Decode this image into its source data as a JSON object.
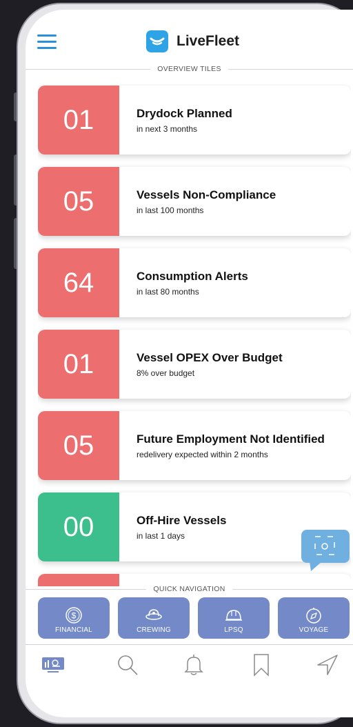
{
  "header": {
    "app_name": "LiveFleet"
  },
  "sections": {
    "overview": "OVERVIEW TILES",
    "quick_nav": "QUICK NAVIGATION"
  },
  "colors": {
    "accent": "#2a8fd8",
    "tile_red": "#ec6e6e",
    "tile_green": "#3cbf8c",
    "nav_button": "#7389c8",
    "chat_fab": "#6fb0e0"
  },
  "tiles": [
    {
      "count": "01",
      "title": "Drydock Planned",
      "subtitle": "in next 3 months",
      "status": "alert"
    },
    {
      "count": "05",
      "title": "Vessels Non-Compliance",
      "subtitle": "in last 100 months",
      "status": "alert"
    },
    {
      "count": "64",
      "title": "Consumption Alerts",
      "subtitle": "in last 80 months",
      "status": "alert"
    },
    {
      "count": "01",
      "title": "Vessel OPEX Over Budget",
      "subtitle": "8% over budget",
      "status": "alert"
    },
    {
      "count": "05",
      "title": "Future Employment Not Identified",
      "subtitle": "redelivery expected within 2 months",
      "status": "alert"
    },
    {
      "count": "00",
      "title": "Off-Hire Vessels",
      "subtitle": "in last 1 days",
      "status": "ok"
    },
    {
      "count": "",
      "title": "",
      "subtitle": "",
      "status": "alert"
    }
  ],
  "quick_nav": [
    {
      "label": "FINANCIAL",
      "icon": "dollar-icon"
    },
    {
      "label": "CREWING",
      "icon": "sailor-hat-icon"
    },
    {
      "label": "LPSQ",
      "icon": "helmet-icon"
    },
    {
      "label": "VOYAGE",
      "icon": "compass-icon"
    }
  ],
  "tabbar": [
    {
      "name": "dashboard",
      "icon": "dashboard-icon",
      "active": true
    },
    {
      "name": "search",
      "icon": "search-icon",
      "active": false
    },
    {
      "name": "notifications",
      "icon": "bell-icon",
      "active": false
    },
    {
      "name": "bookmarks",
      "icon": "bookmark-icon",
      "active": false
    },
    {
      "name": "navigate",
      "icon": "send-arrow-icon",
      "active": false
    }
  ]
}
